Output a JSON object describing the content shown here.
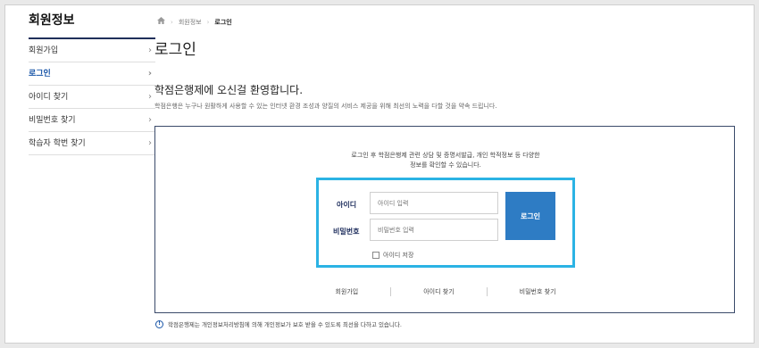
{
  "sidebar": {
    "title": "회원정보",
    "chevron": "›",
    "items": [
      {
        "label": "회원가입",
        "active": false
      },
      {
        "label": "로그인",
        "active": true
      },
      {
        "label": "아이디 찾기",
        "active": false
      },
      {
        "label": "비밀번호 찾기",
        "active": false
      },
      {
        "label": "학습자 학번 찾기",
        "active": false
      }
    ]
  },
  "breadcrumb": {
    "home_icon": "home-icon",
    "separator": "›",
    "items": [
      "회원정보",
      "로그인"
    ]
  },
  "page": {
    "title": "로그인",
    "welcome": "학점은행제에 오신걸 환영합니다.",
    "welcome_sub": "학점은행은 누구나 원활하게 사용할 수 있는 인터넷 환경 조성과 양질의 서비스 제공을 위해 최선의 노력을 다할 것을 약속 드립니다."
  },
  "login": {
    "intro_line1": "로그인 후 학점은행제 관련 상담 및 증명서발급, 개인 학적정보 등 다양한",
    "intro_line2": "정보를 확인할 수 있습니다.",
    "id_label": "아이디",
    "id_placeholder": "아이디 입력",
    "pw_label": "비밀번호",
    "pw_placeholder": "비밀번호 입력",
    "button_label": "로그인",
    "save_id_label": "아이디 저장",
    "accent_color": "#2e7cc4",
    "highlight_color": "#2bb3e4"
  },
  "links": [
    "회원가입",
    "아이디 찾기",
    "비밀번호 찾기"
  ],
  "notice": {
    "icon": "info-icon",
    "text": "학점은행제는 개인정보처리방침에 의해 개인정보가 보호 받을 수 있도록 최선을 다하고 있습니다."
  }
}
